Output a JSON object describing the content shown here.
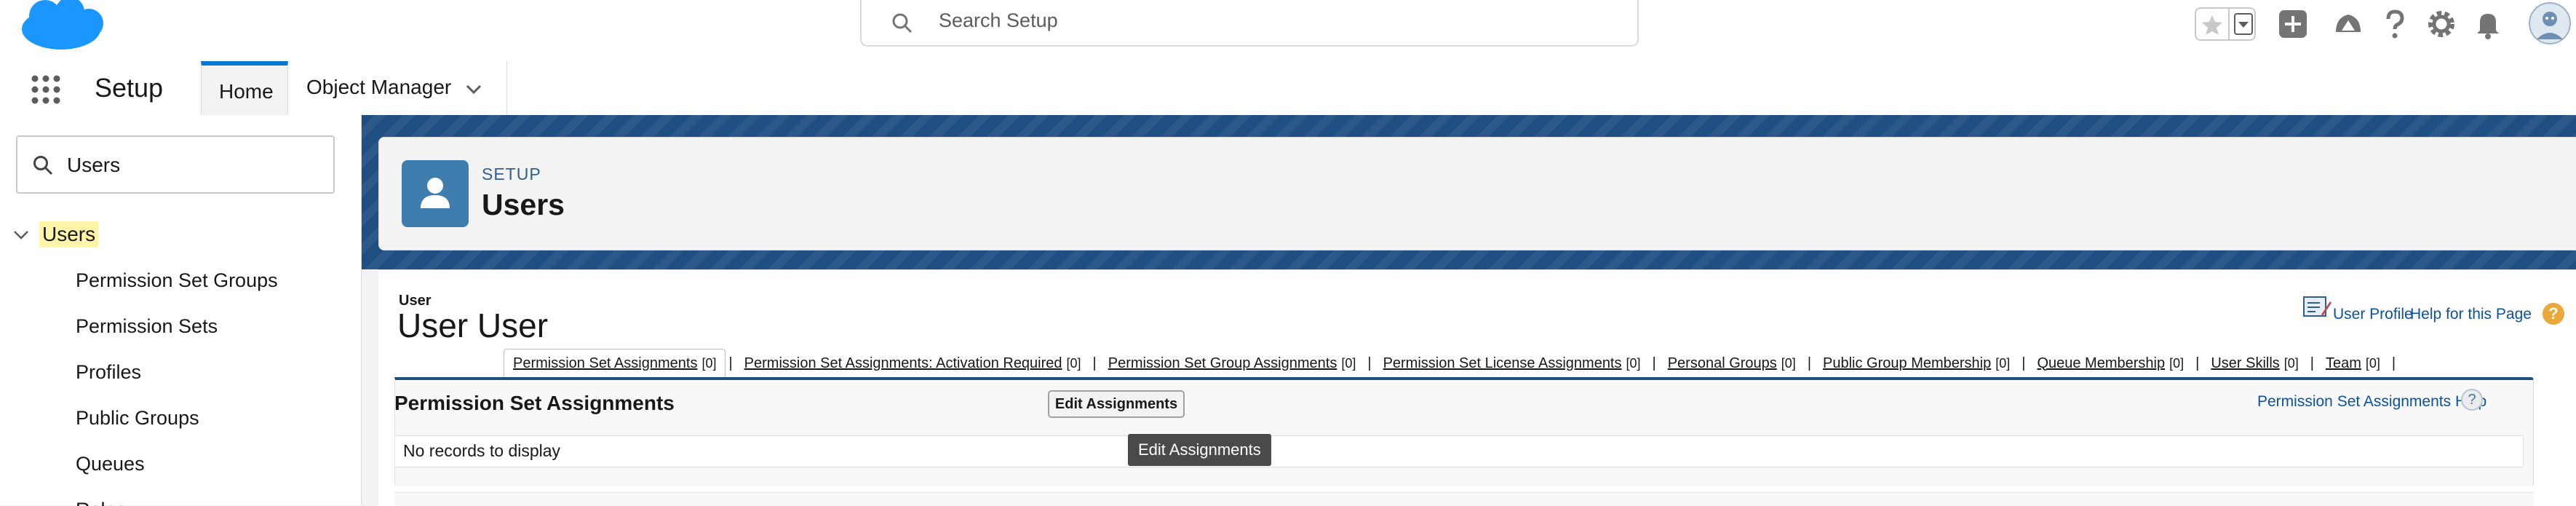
{
  "global_header": {
    "search_placeholder": "Search Setup"
  },
  "app_nav": {
    "app_name": "Setup",
    "tabs": [
      {
        "label": "Home"
      },
      {
        "label": "Object Manager"
      }
    ]
  },
  "sidebar": {
    "quick_find_value": "Users",
    "tree_root": "Users",
    "items": [
      {
        "label": "Permission Set Groups"
      },
      {
        "label": "Permission Sets"
      },
      {
        "label": "Profiles"
      },
      {
        "label": "Public Groups"
      },
      {
        "label": "Queues"
      },
      {
        "label": "Roles"
      }
    ]
  },
  "page_header": {
    "kicker": "SETUP",
    "title": "Users"
  },
  "user_detail": {
    "entity_label": "User",
    "name": "User User",
    "user_profile_link": "User Profile",
    "help_link": "Help for this Page"
  },
  "related_links": [
    {
      "label": "Permission Set Assignments",
      "count": "[0]"
    },
    {
      "label": "Permission Set Assignments: Activation Required",
      "count": "[0]"
    },
    {
      "label": "Permission Set Group Assignments",
      "count": "[0]"
    },
    {
      "label": "Permission Set License Assignments",
      "count": "[0]"
    },
    {
      "label": "Personal Groups",
      "count": "[0]"
    },
    {
      "label": "Public Group Membership",
      "count": "[0]"
    },
    {
      "label": "Queue Membership",
      "count": "[0]"
    },
    {
      "label": "User Skills",
      "count": "[0]"
    },
    {
      "label": "Team",
      "count": "[0]"
    }
  ],
  "permission_set_assignments": {
    "title": "Permission Set Assignments",
    "edit_button": "Edit Assignments",
    "help_link": "Permission Set Assignments Help",
    "empty_text": "No records to display",
    "tooltip": "Edit Assignments"
  },
  "colors": {
    "brand_blue": "#1f4f82",
    "link_blue": "#0a52a4",
    "cloud_blue": "#1b96ff",
    "header_icon": "#3e7dad",
    "highlight": "#fff4a8"
  }
}
